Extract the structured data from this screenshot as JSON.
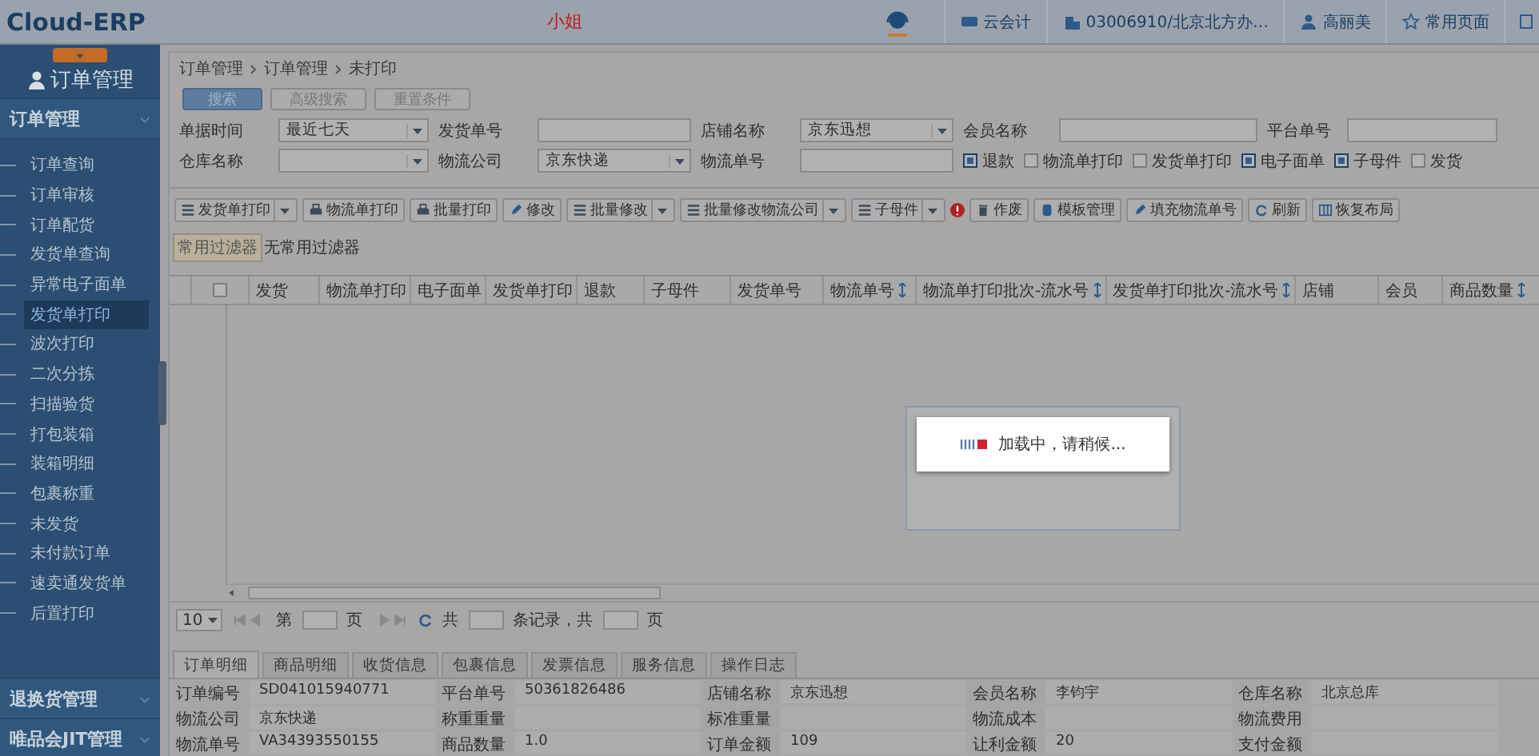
{
  "topbar": {
    "logo": "Cloud-ERP",
    "greeting": "小姐",
    "items": [
      {
        "kind": "accounting",
        "label": "云会计"
      },
      {
        "kind": "company",
        "label": "03006910/北京北方办…"
      },
      {
        "kind": "user",
        "label": "高丽美"
      },
      {
        "kind": "star",
        "label": "常用页面"
      }
    ]
  },
  "sidebar": {
    "module_title": "订单管理",
    "groups": [
      {
        "label": "订单管理",
        "expanded": true,
        "children": [
          {
            "label": "订单查询",
            "selected": false
          },
          {
            "label": "订单审核",
            "selected": false
          },
          {
            "label": "订单配货",
            "selected": false
          },
          {
            "label": "发货单查询",
            "selected": false
          },
          {
            "label": "异常电子面单",
            "selected": false
          },
          {
            "label": "发货单打印",
            "selected": true
          },
          {
            "label": "波次打印",
            "selected": false
          },
          {
            "label": "二次分拣",
            "selected": false
          },
          {
            "label": "扫描验货",
            "selected": false
          },
          {
            "label": "打包装箱",
            "selected": false
          },
          {
            "label": "装箱明细",
            "selected": false
          },
          {
            "label": "包裹称重",
            "selected": false
          },
          {
            "label": "未发货",
            "selected": false
          },
          {
            "label": "未付款订单",
            "selected": false
          },
          {
            "label": "速卖通发货单",
            "selected": false
          },
          {
            "label": "后置打印",
            "selected": false
          }
        ]
      },
      {
        "label": "退换货管理",
        "expanded": false
      },
      {
        "label": "唯品会JIT管理",
        "expanded": false
      }
    ]
  },
  "breadcrumb": [
    "订单管理",
    "订单管理",
    "未打印"
  ],
  "search_buttons": [
    {
      "label": "搜索",
      "kind": "primary"
    },
    {
      "label": "高级搜索",
      "kind": "plain"
    },
    {
      "label": "重置条件",
      "kind": "plain"
    }
  ],
  "filters": [
    [
      {
        "label": "单据时间",
        "kind": "select",
        "value": "最近七天"
      },
      {
        "label": "发货单号",
        "kind": "text"
      },
      {
        "label": "店铺名称",
        "kind": "select",
        "value": "京东迅想"
      },
      {
        "label": "会员名称",
        "kind": "text"
      },
      {
        "label": "平台单号",
        "kind": "text"
      }
    ],
    [
      {
        "label": "仓库名称",
        "kind": "select"
      },
      {
        "label": "物流公司",
        "kind": "select",
        "value": "京东快递"
      },
      {
        "label": "物流单号",
        "kind": "text"
      }
    ]
  ],
  "filter_checks": [
    {
      "label": "退款",
      "checked": true
    },
    {
      "label": "物流单打印",
      "checked": false
    },
    {
      "label": "发货单打印",
      "checked": false
    },
    {
      "label": "电子面单",
      "checked": true
    },
    {
      "label": "子母件",
      "checked": true
    },
    {
      "label": "发货",
      "checked": false
    }
  ],
  "toolbar": [
    {
      "label": "发货单打印",
      "kind": "list",
      "dropdown": true,
      "alert": false
    },
    {
      "label": "物流单打印",
      "kind": "print",
      "dropdown": false,
      "alert": false
    },
    {
      "label": "批量打印",
      "kind": "print",
      "dropdown": false,
      "alert": false
    },
    {
      "label": "修改",
      "kind": "edit",
      "dropdown": false,
      "alert": false
    },
    {
      "label": "批量修改",
      "kind": "list",
      "dropdown": true,
      "alert": false
    },
    {
      "label": "批量修改物流公司",
      "kind": "list",
      "dropdown": true,
      "alert": false
    },
    {
      "label": "子母件",
      "kind": "list",
      "dropdown": true,
      "alert": true
    },
    {
      "label": "作废",
      "kind": "delete",
      "dropdown": false,
      "alert": false
    },
    {
      "label": "模板管理",
      "kind": "template",
      "dropdown": false,
      "alert": false
    },
    {
      "label": "填充物流单号",
      "kind": "edit",
      "dropdown": false,
      "alert": false
    },
    {
      "label": "刷新",
      "kind": "refresh",
      "dropdown": false,
      "alert": false
    },
    {
      "label": "恢复布局",
      "kind": "layout",
      "dropdown": false,
      "alert": false
    }
  ],
  "filter_bar": {
    "chip": "常用过滤器",
    "note": "无常用过滤器"
  },
  "table": {
    "select_all_checked": false,
    "columns": [
      {
        "label": "发货",
        "sortable": false
      },
      {
        "label": "物流单打印",
        "sortable": false
      },
      {
        "label": "电子面单",
        "sortable": false
      },
      {
        "label": "发货单打印",
        "sortable": false
      },
      {
        "label": "退款",
        "sortable": false
      },
      {
        "label": "子母件",
        "sortable": false
      },
      {
        "label": "发货单号",
        "sortable": false
      },
      {
        "label": "物流单号",
        "sortable": true
      },
      {
        "label": "物流单打印批次-流水号",
        "sortable": true
      },
      {
        "label": "发货单打印批次-流水号",
        "sortable": true
      },
      {
        "label": "店铺",
        "sortable": false
      },
      {
        "label": "会员",
        "sortable": false
      },
      {
        "label": "商品数量",
        "sortable": true
      }
    ]
  },
  "loading": {
    "message": "加载中，请稍候..."
  },
  "pagination": {
    "page_size": "10",
    "page_prefix": "第",
    "page_suffix": "页",
    "total_prefix": "共",
    "records_label": "条记录，共",
    "pages_suffix": "页"
  },
  "detail_tabs": [
    {
      "label": "订单明细",
      "selected": true
    },
    {
      "label": "商品明细",
      "selected": false
    },
    {
      "label": "收货信息",
      "selected": false
    },
    {
      "label": "包裹信息",
      "selected": false
    },
    {
      "label": "发票信息",
      "selected": false
    },
    {
      "label": "服务信息",
      "selected": false
    },
    {
      "label": "操作日志",
      "selected": false
    }
  ],
  "detail_rows": [
    [
      {
        "label": "订单编号",
        "value": "SD041015940771"
      },
      {
        "label": "平台单号",
        "value": "50361826486"
      },
      {
        "label": "店铺名称",
        "value": "京东迅想"
      },
      {
        "label": "会员名称",
        "value": "李钧宇"
      },
      {
        "label": "仓库名称",
        "value": "北京总库"
      }
    ],
    [
      {
        "label": "物流公司",
        "value": "京东快递"
      },
      {
        "label": "称重重量"
      },
      {
        "label": "标准重量"
      },
      {
        "label": "物流成本"
      },
      {
        "label": "物流费用"
      }
    ],
    [
      {
        "label": "物流单号",
        "value": "VA34393550155"
      },
      {
        "label": "商品数量",
        "value": "1.0"
      },
      {
        "label": "订单金额",
        "value": "109"
      },
      {
        "label": "让利金额",
        "value": "20"
      },
      {
        "label": "支付金额"
      }
    ]
  ]
}
